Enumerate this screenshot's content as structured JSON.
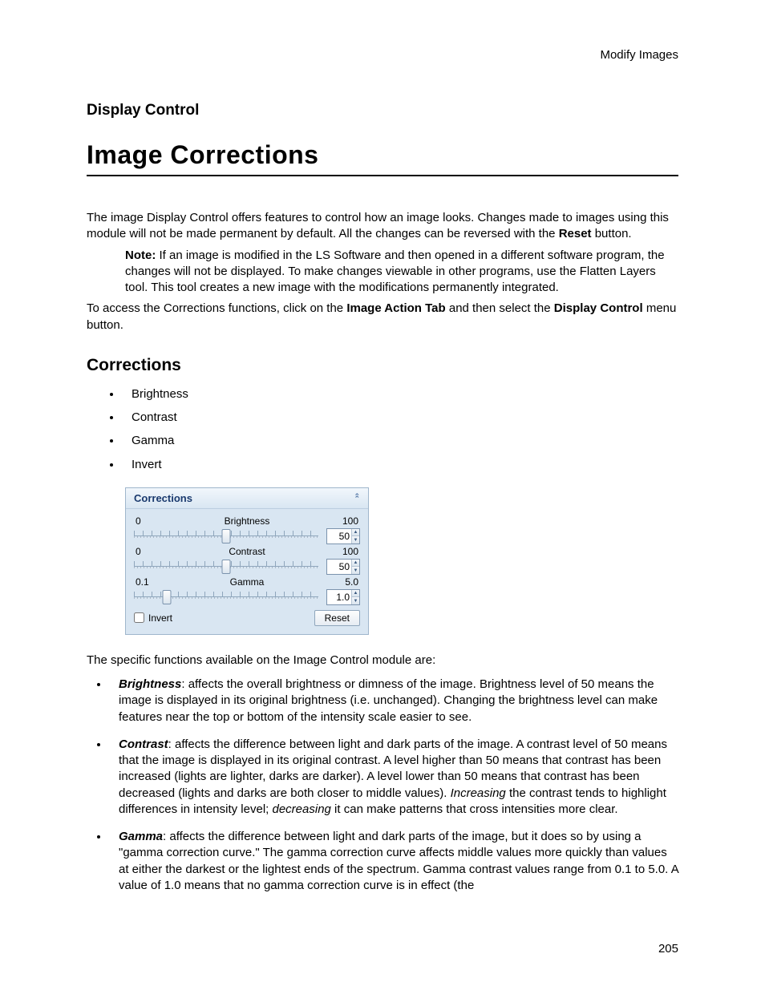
{
  "header": {
    "right": "Modify Images"
  },
  "section_label": "Display Control",
  "title": "Image Corrections",
  "intro": {
    "p1_a": "The image Display Control offers features to control how an image looks. Changes made to images using this module will not be made permanent by default. All the changes can be reversed with the ",
    "p1_bold": "Reset",
    "p1_b": " button."
  },
  "note": {
    "label": "Note:",
    "text": " If an image is modified in the LS Software and then opened in a different software program, the changes will not be displayed. To make changes viewable in other programs, use the Flatten Layers tool. This tool creates a new image with the modifications permanently integrated."
  },
  "access": {
    "a": "To access the Corrections functions, click on the ",
    "b1": "Image Action Tab",
    "c": " and then select the ",
    "b2": "Display Control",
    "d": " menu button."
  },
  "subhead": "Corrections",
  "bullets": [
    "Brightness",
    "Contrast",
    "Gamma",
    "Invert"
  ],
  "panel": {
    "title": "Corrections",
    "sliders": [
      {
        "name": "Brightness",
        "min": "0",
        "max": "100",
        "value": "50",
        "thumb_pct": 50
      },
      {
        "name": "Contrast",
        "min": "0",
        "max": "100",
        "value": "50",
        "thumb_pct": 50
      },
      {
        "name": "Gamma",
        "min": "0.1",
        "max": "5.0",
        "value": "1.0",
        "thumb_pct": 18
      }
    ],
    "invert_label": "Invert",
    "reset_label": "Reset"
  },
  "functions_intro": "The specific functions available on the Image Control module are:",
  "descs": {
    "brightness": {
      "name": "Brightness",
      "text": ": affects the overall brightness or dimness of the image. Brightness level of 50 means the image is displayed in its original brightness (i.e. unchanged). Changing the brightness level can make features near the top or bottom of the intensity scale easier to see."
    },
    "contrast": {
      "name": "Contrast",
      "text_a": ": affects the difference between light and dark parts of the image. A contrast level of 50 means that the image is displayed in its original contrast. A level higher than 50 means that contrast has been increased (lights are lighter, darks are darker). A level lower than 50 means that contrast has been decreased (lights and darks are both closer to middle values). ",
      "em1": "Increasing",
      "text_b": " the contrast tends to highlight differences in intensity level; ",
      "em2": "decreasing",
      "text_c": " it can make patterns that cross intensities more clear."
    },
    "gamma": {
      "name": "Gamma",
      "text": ": affects the difference between light and dark parts of the image, but it does so by using a \"gamma correction curve.\" The gamma correction curve affects middle values more quickly than values at either the darkest or the lightest ends of the spectrum. Gamma contrast values range from 0.1 to 5.0. A value of 1.0 means that no gamma correction curve is in effect (the"
    }
  },
  "page_number": "205"
}
